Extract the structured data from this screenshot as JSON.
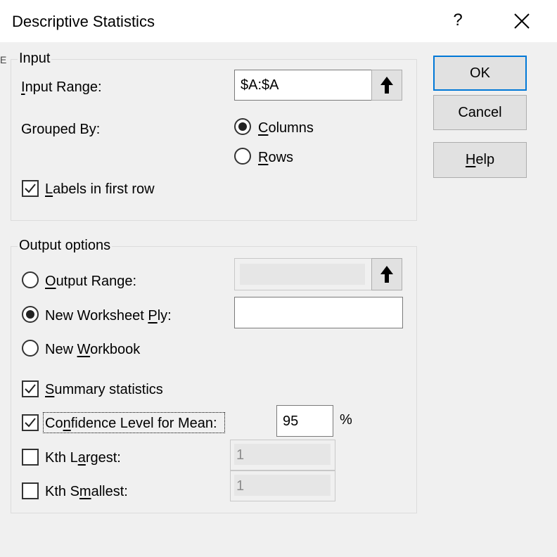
{
  "window": {
    "title": "Descriptive Statistics",
    "help_glyph": "?",
    "close_icon": "close-icon"
  },
  "ghost": {
    "letter": "E"
  },
  "input_group": {
    "legend": "Input",
    "input_range": {
      "pre": "",
      "access": "I",
      "post": "nput Range:",
      "value": "$A:$A"
    },
    "grouped_by": {
      "label": "Grouped By:"
    },
    "columns": {
      "pre": "",
      "access": "C",
      "post": "olumns",
      "selected": true
    },
    "rows": {
      "pre": "",
      "access": "R",
      "post": "ows",
      "selected": false
    },
    "labels_first_row": {
      "pre": "",
      "access": "L",
      "post": "abels in first row",
      "checked": true
    }
  },
  "output_group": {
    "legend": "Output options",
    "output_range": {
      "pre": "",
      "access": "O",
      "post": "utput Range:",
      "selected": false,
      "value": ""
    },
    "new_worksheet": {
      "pre": "New Worksheet ",
      "access": "P",
      "post": "ly:",
      "selected": true,
      "value": ""
    },
    "new_workbook": {
      "pre": "New ",
      "access": "W",
      "post": "orkbook",
      "selected": false
    },
    "summary_statistics": {
      "pre": "",
      "access": "S",
      "post": "ummary statistics",
      "checked": true
    },
    "confidence_level": {
      "pre": "Co",
      "access": "n",
      "post": "fidence Level for Mean:",
      "checked": true,
      "value": "95",
      "unit": "%"
    },
    "kth_largest": {
      "pre": "Kth L",
      "access": "a",
      "post": "rgest:",
      "checked": false,
      "value": "1"
    },
    "kth_smallest": {
      "pre": "Kth S",
      "access": "m",
      "post": "allest:",
      "checked": false,
      "value": "1"
    }
  },
  "buttons": {
    "ok": {
      "label": "OK"
    },
    "cancel": {
      "label": "Cancel"
    },
    "help": {
      "pre": "",
      "access": "H",
      "post": "elp"
    }
  },
  "icons": {
    "range_select": "up-arrow-icon"
  },
  "colors": {
    "default_button_border": "#0078d7",
    "dialog_background": "#f0f0f0"
  }
}
